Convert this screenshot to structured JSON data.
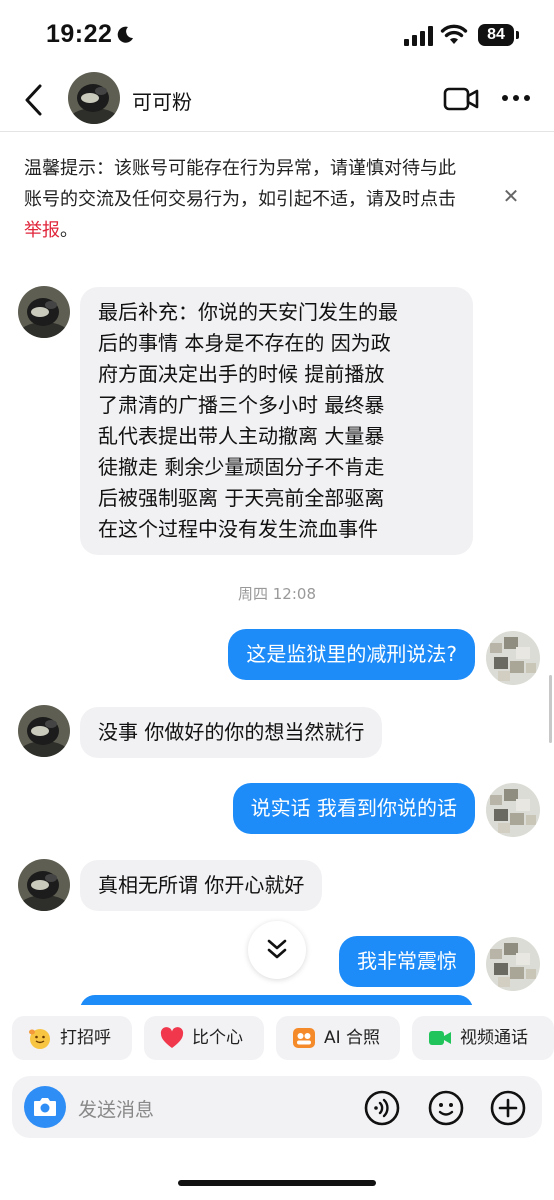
{
  "status": {
    "time": "19:22",
    "battery": "84"
  },
  "header": {
    "name": "可可粉"
  },
  "warning": {
    "text": "温馨提示：该账号可能存在行为异常，请谨慎对待与此账号的交流及任何交易行为，如引起不适，请及时点击",
    "link": "举报",
    "suffix": "。"
  },
  "messages": [
    {
      "side": "in",
      "lines": [
        "最后补充：你说的天安门发生的最",
        "后的事情 本身是不存在的 因为政",
        "府方面决定出手的时候 提前播放",
        "了肃清的广播三个多小时 最终暴",
        "乱代表提出带人主动撤离  大量暴",
        "徒撤走 剩余少量顽固分子不肯走",
        "后被强制驱离 于天亮前全部驱离",
        "在这个过程中没有发生流血事件"
      ]
    },
    {
      "side": "out",
      "text": "这是监狱里的减刑说法?"
    },
    {
      "side": "in",
      "text": "没事 你做好的你的想当然就行"
    },
    {
      "side": "out",
      "text": "说实话 我看到你说的话"
    },
    {
      "side": "in",
      "text": "真相无所谓 你开心就好"
    },
    {
      "side": "out",
      "text": "我非常震惊"
    }
  ],
  "timestamp": "周四 12:08",
  "quick_actions": [
    "打招呼",
    "比个心",
    "AI 合照",
    "视频通话"
  ],
  "input": {
    "placeholder": "发送消息"
  },
  "icons": [
    "moon-icon",
    "signal-icon",
    "wifi-icon",
    "back-arrow-icon",
    "video-call-icon",
    "more-icon",
    "close-icon",
    "chevron-double-down-icon",
    "wave-emoji-icon",
    "heart-icon",
    "ai-photo-icon",
    "video-chat-icon",
    "camera-icon",
    "voice-icon",
    "emoji-icon",
    "plus-icon"
  ],
  "colors": {
    "accent": "#1d8cf8",
    "link_red": "#e0263b",
    "bubble_in": "#f1f1f3",
    "chip_bg": "#f2f2f4"
  }
}
